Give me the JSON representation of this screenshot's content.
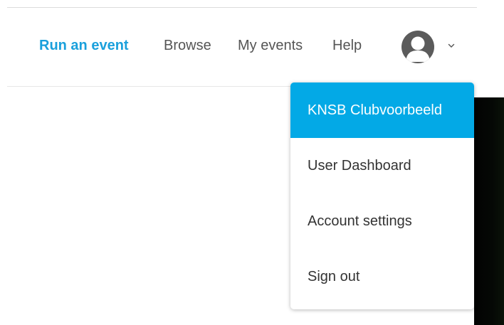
{
  "nav": {
    "run_event": "Run an event",
    "browse": "Browse",
    "my_events": "My events",
    "help": "Help"
  },
  "account": {
    "avatar_icon": "user-avatar-icon",
    "chevron_icon": "chevron-down-icon"
  },
  "dropdown": {
    "items": [
      {
        "label": "KNSB Clubvoorbeeld",
        "active": true
      },
      {
        "label": "User Dashboard",
        "active": false
      },
      {
        "label": "Account settings",
        "active": false
      },
      {
        "label": "Sign out",
        "active": false
      }
    ]
  },
  "colors": {
    "brand": "#1aa0dc",
    "active_item": "#03a9e6",
    "nav_text": "#555555"
  }
}
